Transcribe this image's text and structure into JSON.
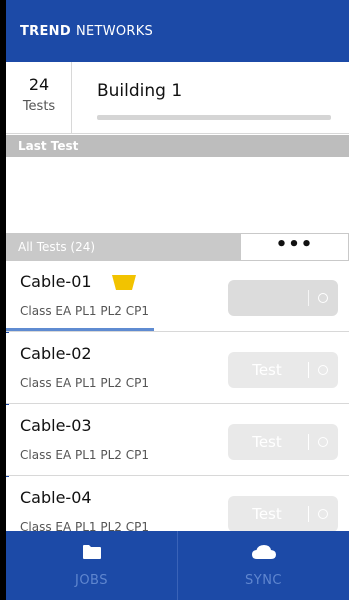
{
  "header": {
    "brand_bold": "TREND",
    "brand_rest": "NETWORKS"
  },
  "job": {
    "test_count": "24",
    "test_count_label": "Tests",
    "name": "Building 1"
  },
  "last_test": {
    "heading": "Last Test"
  },
  "all_tests": {
    "heading": "All Tests (24)",
    "more_label": "•••"
  },
  "tests": [
    {
      "name": "Cable-01",
      "spec": "Class EA PL1 PL2 CP1",
      "button": "",
      "flag_color": "#f2c300"
    },
    {
      "name": "Cable-02",
      "spec": "Class EA PL1 PL2 CP1",
      "button": "Test"
    },
    {
      "name": "Cable-03",
      "spec": "Class EA PL1 PL2 CP1",
      "button": "Test"
    },
    {
      "name": "Cable-04",
      "spec": "Class EA PL1 PL2 CP1",
      "button": "Test"
    }
  ],
  "nav": {
    "jobs": {
      "label": "JOBS",
      "icon": "folder-icon"
    },
    "sync": {
      "label": "SYNC",
      "icon": "cloud-icon"
    }
  },
  "colors": {
    "primary": "#1c4aa7",
    "flag": "#f2c300"
  }
}
